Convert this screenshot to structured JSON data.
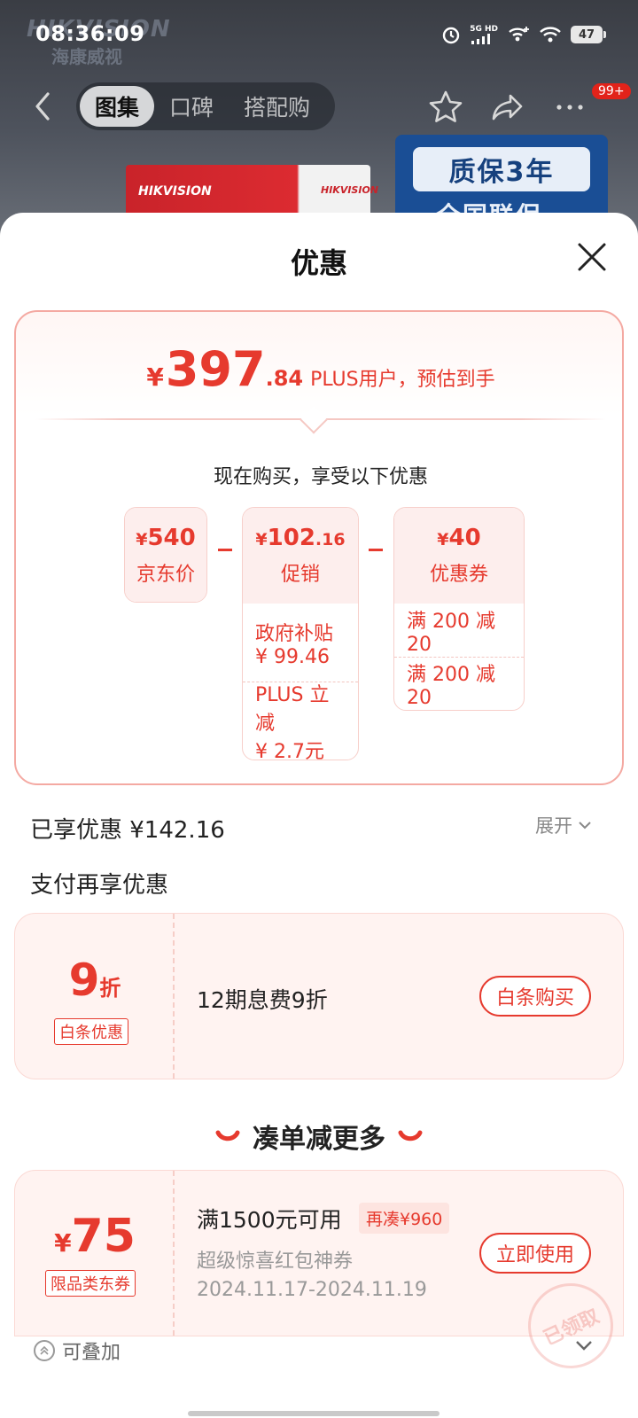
{
  "status_bar": {
    "time": "08:36:09",
    "network": "5G HD",
    "battery": "47"
  },
  "background": {
    "brand_logo": "HIKVISION",
    "brand_logo_cn": "海康威视",
    "box_brand": "HIKVISION",
    "box_brand_cn": "海康威视",
    "warranty_line1": "质保3年",
    "warranty_line2": "全国联保"
  },
  "top_nav": {
    "tabs": [
      {
        "label": "图集",
        "active": true
      },
      {
        "label": "口碑",
        "active": false
      },
      {
        "label": "搭配购",
        "active": false
      }
    ],
    "more_badge": "99+",
    "icons": [
      "back-icon",
      "star-icon",
      "share-icon",
      "more-icon"
    ]
  },
  "sheet": {
    "title": "优惠",
    "estimate": {
      "currency": "¥",
      "integer": "397",
      "decimal": ".84",
      "label": "PLUS用户，预估到手"
    },
    "buy_now_text": "现在购买，享受以下优惠",
    "breakdown": {
      "jd_price": {
        "currency": "¥",
        "amount": "540",
        "label": "京东价"
      },
      "promotion": {
        "currency": "¥",
        "amount": "102",
        "decimal": ".16",
        "label": "促销",
        "items": [
          {
            "name": "政府补贴",
            "value": "¥ 99.46"
          },
          {
            "name": "PLUS 立减",
            "value": "¥ 2.7元"
          }
        ]
      },
      "coupon": {
        "currency": "¥",
        "amount": "40",
        "label": "优惠券",
        "items": [
          "满 200 减 20",
          "满 200 减 20"
        ]
      }
    },
    "enjoyed_label": "已享优惠 ¥142.16",
    "expand_label": "展开",
    "pay_title": "支付再享优惠",
    "baitiao": {
      "discount_num": "9",
      "discount_unit": "折",
      "tag": "白条优惠",
      "desc": "12期息费9折",
      "button": "白条购买"
    },
    "more_title": "凑单减更多",
    "coupon75": {
      "currency": "¥",
      "amount": "75",
      "tag": "限品类东券",
      "condition": "满1500元可用",
      "extra": "再凑¥960",
      "name": "超级惊喜红包神券",
      "validity": "2024.11.17-2024.11.19",
      "button": "立即使用",
      "stamp": "已领取"
    },
    "stackable": "可叠加"
  },
  "colors": {
    "accent": "#e63a2e",
    "card_border": "#f4a9a2",
    "coupon_bg": "#fff3f1",
    "warranty_blue": "#1a4e95"
  }
}
